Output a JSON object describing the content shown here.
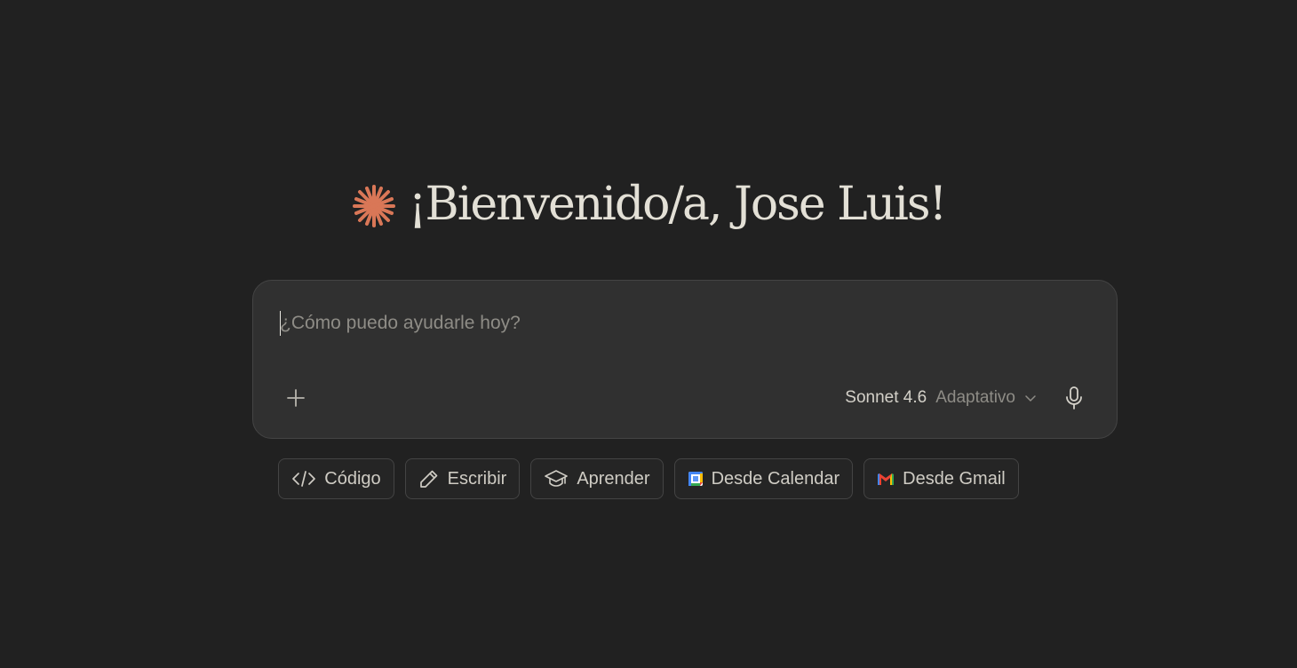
{
  "greeting": {
    "text": "¡Bienvenido/a, Jose Luis!",
    "icon": "sparkle-icon",
    "accent": "#d97757"
  },
  "composer": {
    "placeholder": "¿Cómo puedo ayudarle hoy?",
    "add_icon": "plus-icon",
    "model_name": "Sonnet 4.6",
    "model_mode": "Adaptativo",
    "mode_icon": "chevron-down-icon",
    "mic_icon": "microphone-icon"
  },
  "chips": [
    {
      "label": "Código",
      "icon": "code-icon"
    },
    {
      "label": "Escribir",
      "icon": "pencil-icon"
    },
    {
      "label": "Aprender",
      "icon": "graduation-cap-icon"
    },
    {
      "label": "Desde Calendar",
      "icon": "google-calendar-icon"
    },
    {
      "label": "Desde Gmail",
      "icon": "gmail-icon"
    }
  ],
  "colors": {
    "background": "#212121",
    "composer_bg": "#303030",
    "text": "#c9c7c0"
  }
}
